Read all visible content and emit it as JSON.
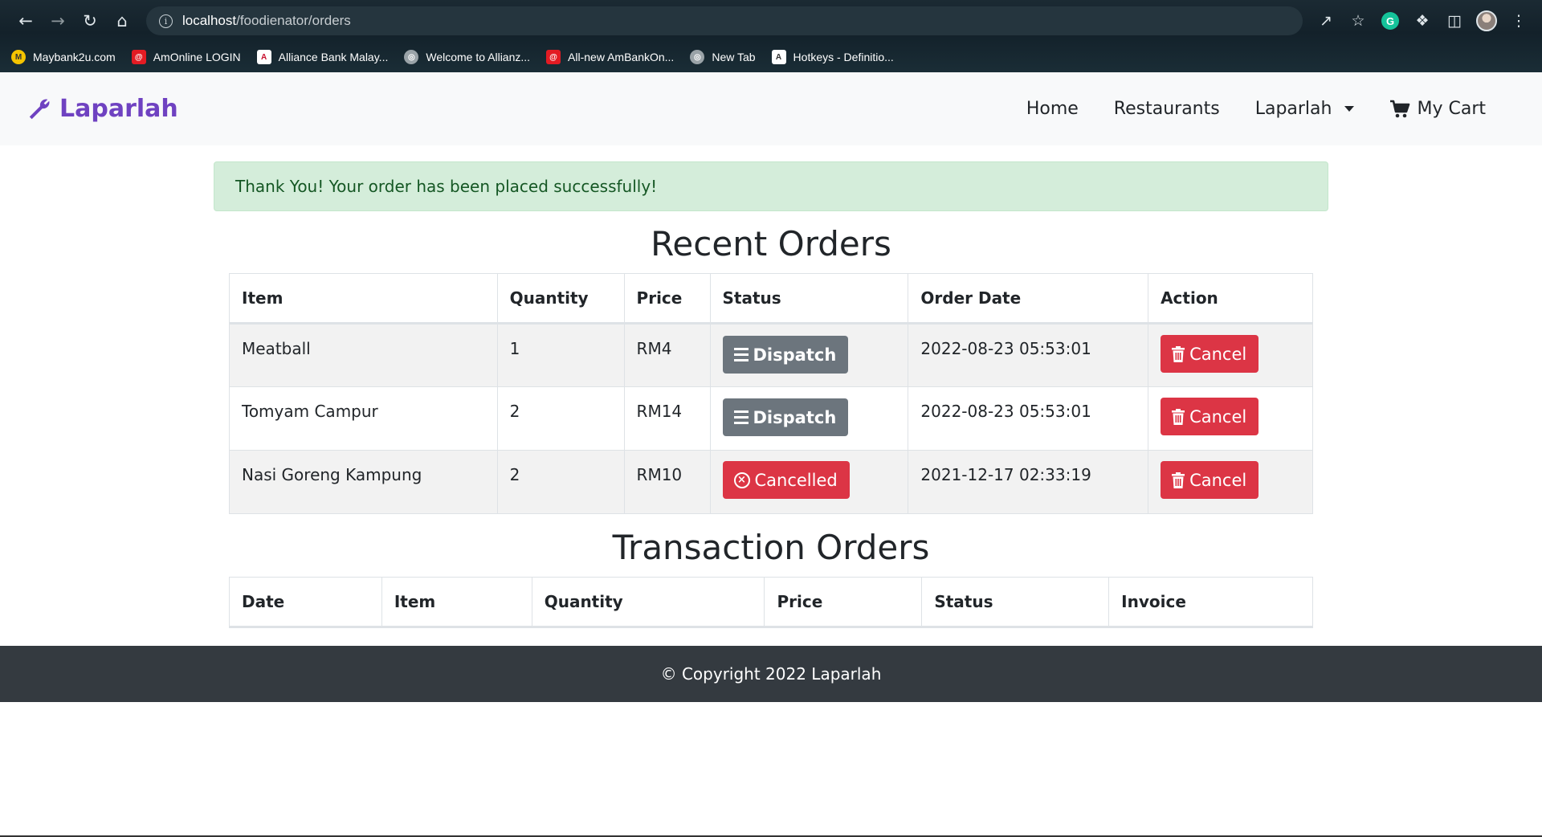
{
  "browser": {
    "url_host": "localhost",
    "url_path": "/foodienator/orders",
    "bookmarks": [
      {
        "label": "Maybank2u.com",
        "color": "#f5c400"
      },
      {
        "label": "AmOnline LOGIN",
        "color": "#e31b23"
      },
      {
        "label": "Alliance Bank Malay...",
        "color": "#ffffff"
      },
      {
        "label": "Welcome to Allianz...",
        "color": "#9aa3a8"
      },
      {
        "label": "All-new AmBankOn...",
        "color": "#e31b23"
      },
      {
        "label": "New Tab",
        "color": "#9aa3a8"
      },
      {
        "label": "Hotkeys - Definitio...",
        "color": "#ffffff"
      }
    ]
  },
  "navbar": {
    "brand": "Laparlah",
    "brand_color": "#6f42c1",
    "links": {
      "home": "Home",
      "restaurants": "Restaurants",
      "laparlah": "Laparlah",
      "cart": "My Cart"
    }
  },
  "alert": {
    "message": "Thank You! Your order has been placed successfully!"
  },
  "recent_orders": {
    "title": "Recent Orders",
    "columns": [
      "Item",
      "Quantity",
      "Price",
      "Status",
      "Order Date",
      "Action"
    ],
    "rows": [
      {
        "item": "Meatball",
        "quantity": "1",
        "price": "RM4",
        "status": "Dispatch",
        "status_type": "dispatch",
        "date": "2022-08-23 05:53:01",
        "action": "Cancel"
      },
      {
        "item": "Tomyam Campur",
        "quantity": "2",
        "price": "RM14",
        "status": "Dispatch",
        "status_type": "dispatch",
        "date": "2022-08-23 05:53:01",
        "action": "Cancel"
      },
      {
        "item": "Nasi Goreng Kampung",
        "quantity": "2",
        "price": "RM10",
        "status": "Cancelled",
        "status_type": "cancelled",
        "date": "2021-12-17 02:33:19",
        "action": "Cancel"
      }
    ]
  },
  "transaction_orders": {
    "title": "Transaction Orders",
    "columns": [
      "Date",
      "Item",
      "Quantity",
      "Price",
      "Status",
      "Invoice"
    ]
  },
  "footer": {
    "text": "© Copyright 2022 Laparlah"
  },
  "colors": {
    "success_bg": "#d4edda",
    "danger": "#dc3545",
    "secondary": "#6c757d",
    "footer_bg": "#343a40"
  }
}
